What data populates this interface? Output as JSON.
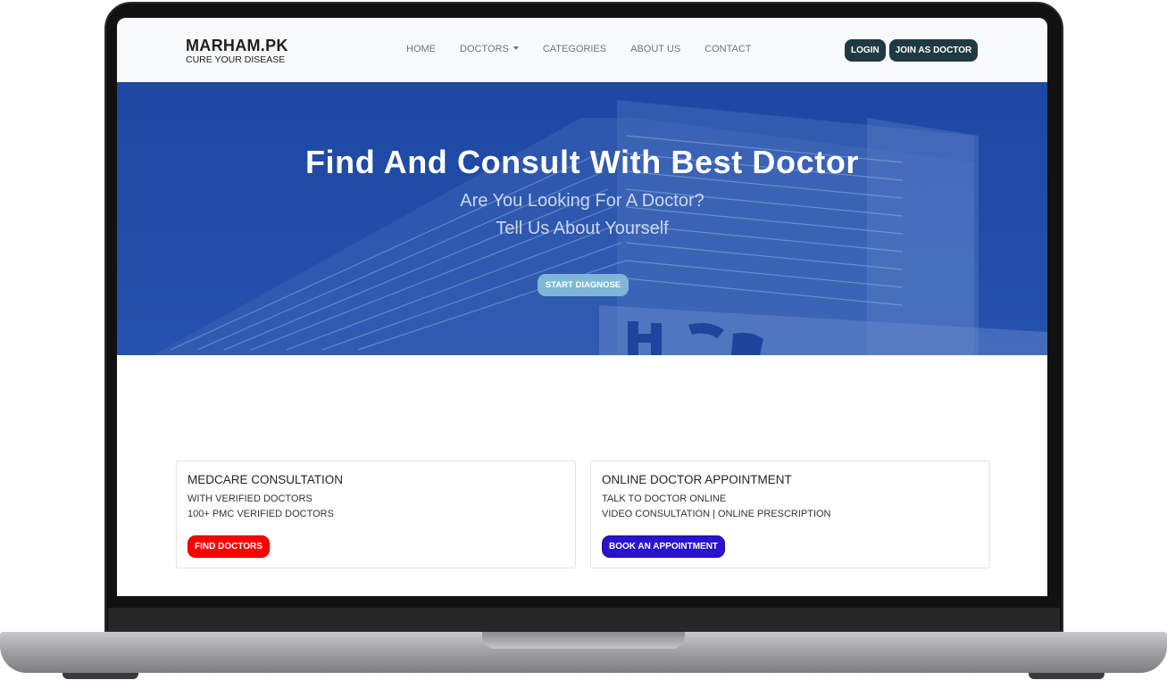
{
  "brand": {
    "title": "MARHAM.PK",
    "tagline": "CURE YOUR DISEASE"
  },
  "nav": {
    "items": [
      "HOME",
      "DOCTORS",
      "CATEGORIES",
      "ABOUT US",
      "CONTACT"
    ],
    "login_label": "LOGIN",
    "join_label": "JOIN AS DOCTOR"
  },
  "hero": {
    "title": "Find And Consult With Best Doctor",
    "subtitle_line1": "Are You Looking For A Doctor?",
    "subtitle_line2": "Tell Us About Yourself",
    "cta_label": "START DIAGNOSE"
  },
  "cards": [
    {
      "title": "MEDCARE CONSULTATION",
      "line1": "WITH VERIFIED DOCTORS",
      "line2": "100+ PMC VERIFIED DOCTORS",
      "button_label": "FIND DOCTORS",
      "button_color": "#ff0000"
    },
    {
      "title": "ONLINE DOCTOR APPOINTMENT",
      "line1": "TALK TO DOCTOR ONLINE",
      "line2": "VIDEO CONSULTATION | ONLINE PRESCRIPTION",
      "button_label": "BOOK AN APPOINTMENT",
      "button_color": "#2a13cf"
    }
  ],
  "colors": {
    "hero_bg": "#1f4aa3",
    "nav_button": "#203a43",
    "cta": "#7eb8d6"
  }
}
